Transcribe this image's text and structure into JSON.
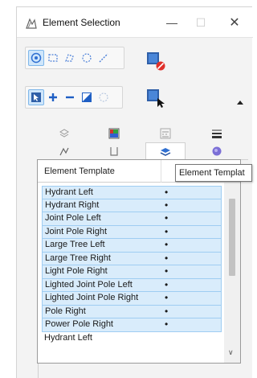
{
  "window": {
    "title": "Element Selection",
    "minimize_glyph": "—",
    "maximize_glyph": "☐",
    "close_glyph": "✕"
  },
  "toolbar": {
    "method_group": [
      "individual-select-icon",
      "block-select-icon",
      "shape-select-icon",
      "circle-select-icon",
      "line-select-icon"
    ],
    "mode_group": [
      "new-selection-icon",
      "add-icon",
      "subtract-icon",
      "invert-icon",
      "clear-icon"
    ],
    "colors": {
      "accent": "#2f6fd1",
      "selected_bg": "#cfe6fb",
      "clear_red": "#e0302a"
    }
  },
  "tabs": {
    "row1": [
      "level-tab-icon",
      "color-tab-icon",
      "style-tab-icon",
      "weight-tab-icon"
    ],
    "row2": [
      "element-type-tab-icon",
      "class-tab-icon",
      "template-tab-icon",
      "symbology-tab-icon"
    ],
    "active_index": 2
  },
  "list": {
    "column_header": "Element Template",
    "rows": [
      {
        "name": "Hydrant Left",
        "mark": "•",
        "selected": true
      },
      {
        "name": "Hydrant Right",
        "mark": "•",
        "selected": true
      },
      {
        "name": "Joint Pole Left",
        "mark": "•",
        "selected": true
      },
      {
        "name": "Joint Pole Right",
        "mark": "•",
        "selected": true
      },
      {
        "name": "Large Tree Left",
        "mark": "•",
        "selected": true
      },
      {
        "name": "Large Tree Right",
        "mark": "•",
        "selected": true
      },
      {
        "name": "Light Pole Right",
        "mark": "•",
        "selected": true
      },
      {
        "name": "Lighted Joint Pole Left",
        "mark": "•",
        "selected": true
      },
      {
        "name": "Lighted Joint Pole Right",
        "mark": "•",
        "selected": true
      },
      {
        "name": "Pole Right",
        "mark": "•",
        "selected": true
      },
      {
        "name": "Power Pole Right",
        "mark": "•",
        "selected": true
      },
      {
        "name": "Hydrant Left",
        "mark": "",
        "selected": false
      }
    ],
    "row_bg": "#d9ecfb"
  },
  "tooltip": {
    "text": "Element Templat"
  }
}
